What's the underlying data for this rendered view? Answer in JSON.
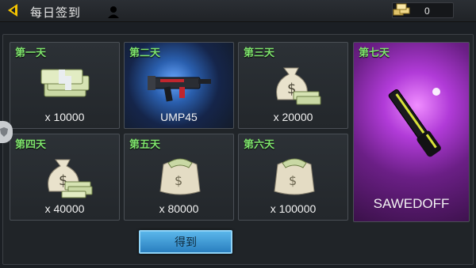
{
  "header": {
    "title": "每日签到",
    "currency_amount": "0"
  },
  "rewards": [
    {
      "day": "第一天",
      "amount": "x 10000",
      "art": "cash-stack"
    },
    {
      "day": "第二天",
      "amount": "UMP45",
      "art": "ump45-weapon"
    },
    {
      "day": "第三天",
      "amount": "x 20000",
      "art": "money-bag-with-cash"
    },
    {
      "day": "第四天",
      "amount": "x 40000",
      "art": "money-bag-with-cash"
    },
    {
      "day": "第五天",
      "amount": "x 80000",
      "art": "money-sack"
    },
    {
      "day": "第六天",
      "amount": "x 100000",
      "art": "money-sack"
    },
    {
      "day": "第七天",
      "amount": "SAWEDOFF",
      "art": "sawedoff-weapon"
    }
  ],
  "claim_button": "得到",
  "colors": {
    "day_label": "#7ee36c",
    "button": "#3f9bd6"
  }
}
